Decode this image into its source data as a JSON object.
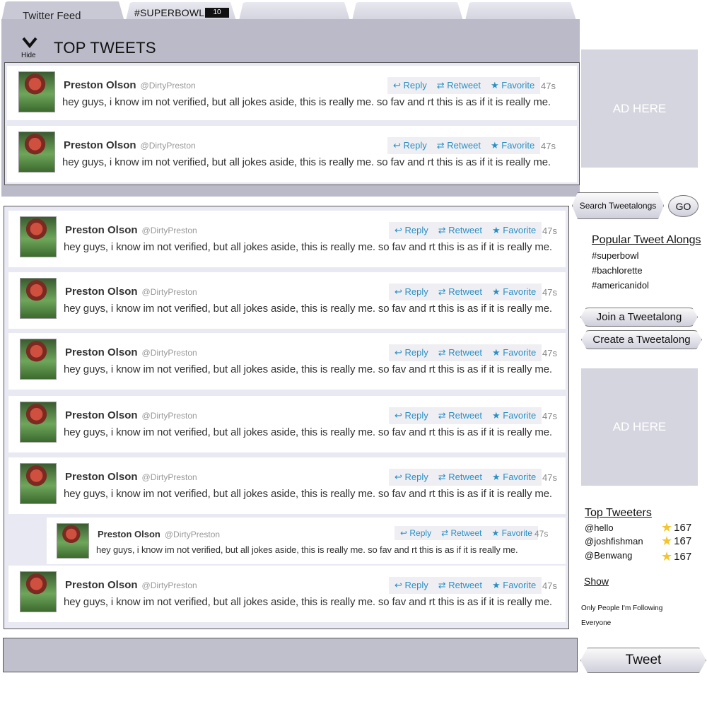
{
  "tabs": [
    {
      "label": "Twitter Feed"
    },
    {
      "label": "#SUPERBOWL",
      "badge": "10"
    },
    {
      "label": ""
    },
    {
      "label": ""
    },
    {
      "label": ""
    }
  ],
  "top_panel": {
    "hide_label": "Hide",
    "title": "TOP TWEETS"
  },
  "tweet": {
    "name": "Preston Olson",
    "handle": "@DirtyPreston",
    "text": "hey guys, i know im not verified, but all jokes aside, this is really me. so fav and rt this is as if it is really me.",
    "reply": "Reply",
    "retweet": "Retweet",
    "favorite": "Favorite",
    "time": "47s"
  },
  "sidebar": {
    "ad_label": "AD HERE",
    "search_button": "Search Tweetalongs",
    "go_button": "GO",
    "popular_title": "Popular Tweet Alongs",
    "popular": [
      "#superbowl",
      "#bachlorette",
      "#americanidol"
    ],
    "join_button": "Join a Tweetalong",
    "create_button": "Create a Tweetalong",
    "top_tweeters_title": "Top Tweeters",
    "top_tweeters": [
      {
        "handle": "@hello",
        "score": "167"
      },
      {
        "handle": "@joshfishman",
        "score": "167"
      },
      {
        "handle": "@Benwang",
        "score": "167"
      }
    ],
    "show_title": "Show",
    "show_options": [
      "Only People I'm Following",
      "Everyone"
    ],
    "tweet_button": "Tweet"
  },
  "colors": {
    "panel": "#babac8",
    "list_bg": "#e9e9f3",
    "link": "#2a8fc4",
    "ad_bg": "#d5d5e0"
  }
}
